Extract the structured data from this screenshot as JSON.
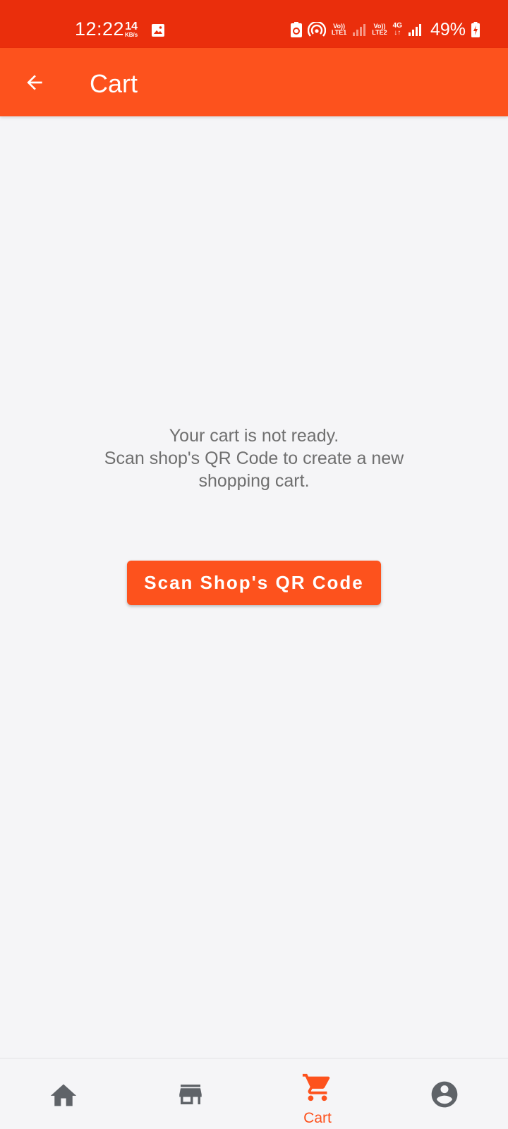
{
  "status_bar": {
    "time": "12:22",
    "speed_value": "14",
    "speed_unit": "KB/s",
    "volte1_top": "Vo))",
    "volte1_bottom": "LTE1",
    "volte2_top": "Vo))",
    "volte2_bottom": "LTE2",
    "network_type": "4G",
    "battery": "49%"
  },
  "app_bar": {
    "title": "Cart",
    "back_icon": "arrow-back-icon"
  },
  "empty_state": {
    "line1": "Your cart is not ready.",
    "line2": "Scan shop's QR Code to create a new",
    "line3": "shopping cart."
  },
  "scan_button": {
    "label": "Scan Shop's QR Code"
  },
  "bottom_nav": {
    "items": [
      {
        "icon": "home-icon",
        "label": "",
        "active": false
      },
      {
        "icon": "store-icon",
        "label": "",
        "active": false
      },
      {
        "icon": "cart-icon",
        "label": "Cart",
        "active": true
      },
      {
        "icon": "account-circle-icon",
        "label": "",
        "active": false
      }
    ]
  },
  "colors": {
    "status_bar": "#ea2e0c",
    "app_bar": "#fd521d",
    "accent": "#fd521d",
    "background": "#f5f5f7",
    "inactive_icon": "#5f6368",
    "message_text": "#6f6f6f"
  }
}
